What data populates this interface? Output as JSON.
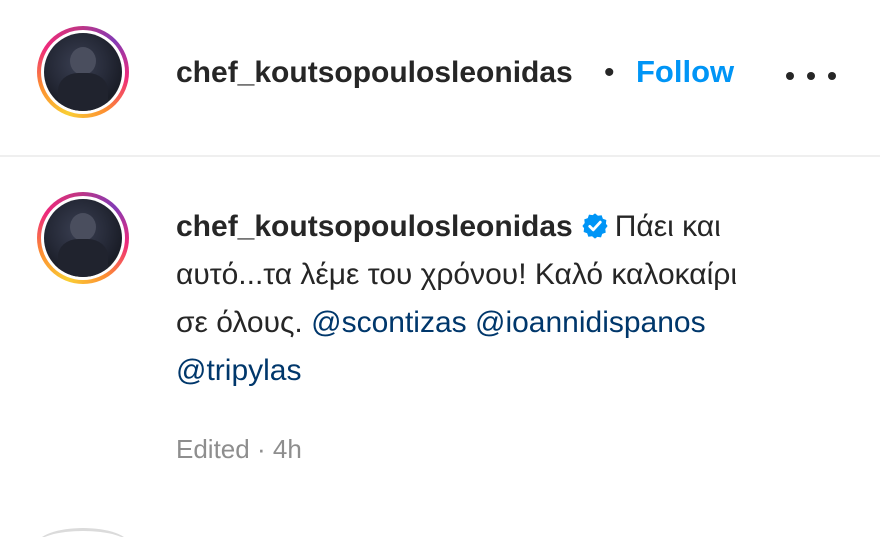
{
  "header": {
    "username": "chef_koutsopoulosleonidas",
    "separator": "•",
    "follow_label": "Follow",
    "more_icon": "more-horizontal-icon"
  },
  "caption": {
    "username": "chef_koutsopoulosleonidas",
    "verified_icon": "verified-badge-icon",
    "text": "Πάει και αυτό...τα λέμε του χρόνου! Καλό καλοκαίρι σε όλους.",
    "mentions": [
      "@scontizas",
      "@ioannidispanos",
      "@tripylas"
    ]
  },
  "meta": {
    "edited": "Edited",
    "separator": "·",
    "time": "4h"
  },
  "colors": {
    "link": "#0095f6",
    "mention": "#00376b",
    "muted": "#8e8e8e",
    "verified": "#0095f6"
  }
}
